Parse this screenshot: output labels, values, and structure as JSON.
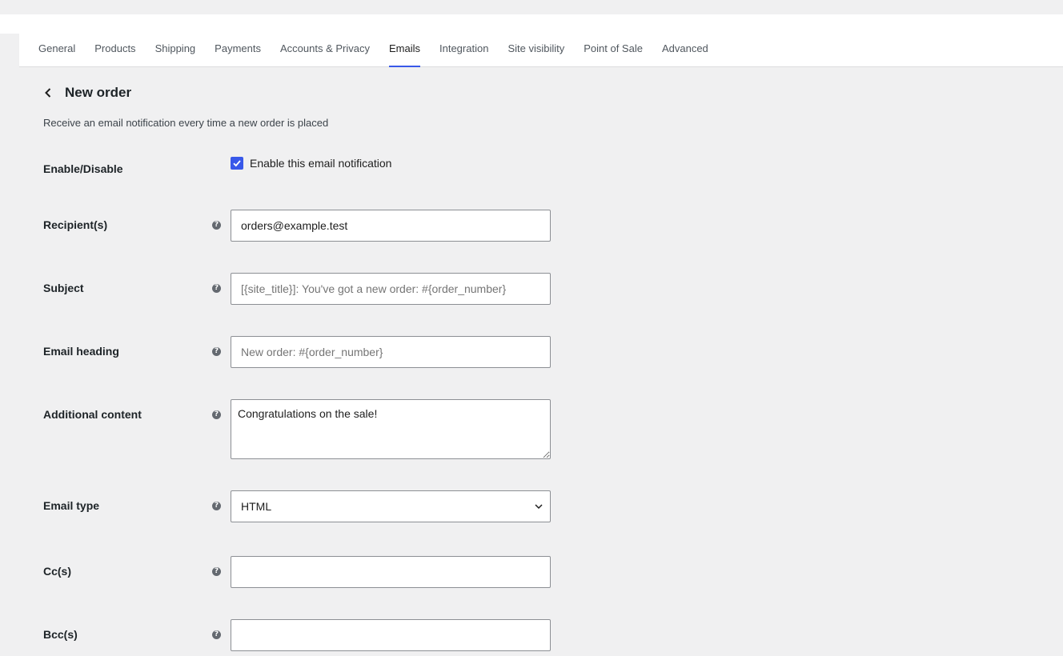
{
  "tabs": [
    {
      "label": "General"
    },
    {
      "label": "Products"
    },
    {
      "label": "Shipping"
    },
    {
      "label": "Payments"
    },
    {
      "label": "Accounts & Privacy"
    },
    {
      "label": "Emails"
    },
    {
      "label": "Integration"
    },
    {
      "label": "Site visibility"
    },
    {
      "label": "Point of Sale"
    },
    {
      "label": "Advanced"
    }
  ],
  "active_tab": "Emails",
  "page": {
    "title": "New order",
    "description": "Receive an email notification every time a new order is placed"
  },
  "form": {
    "enable": {
      "label": "Enable/Disable",
      "checkbox_label": "Enable this email notification",
      "checked": true
    },
    "recipients": {
      "label": "Recipient(s)",
      "value": "orders@example.test",
      "placeholder": ""
    },
    "subject": {
      "label": "Subject",
      "value": "",
      "placeholder": "[{site_title}]: You've got a new order: #{order_number}"
    },
    "email_heading": {
      "label": "Email heading",
      "value": "",
      "placeholder": "New order: #{order_number}"
    },
    "additional_content": {
      "label": "Additional content",
      "value": "Congratulations on the sale!"
    },
    "email_type": {
      "label": "Email type",
      "value": "HTML"
    },
    "cc": {
      "label": "Cc(s)",
      "value": ""
    },
    "bcc": {
      "label": "Bcc(s)",
      "value": ""
    }
  },
  "icons": {
    "help": "question-circle-icon",
    "back": "chevron-left-icon",
    "select": "chevron-down-icon",
    "check": "check-icon"
  },
  "colors": {
    "accent": "#3858e9",
    "background": "#f0f0f1",
    "help_icon": "#646970"
  }
}
